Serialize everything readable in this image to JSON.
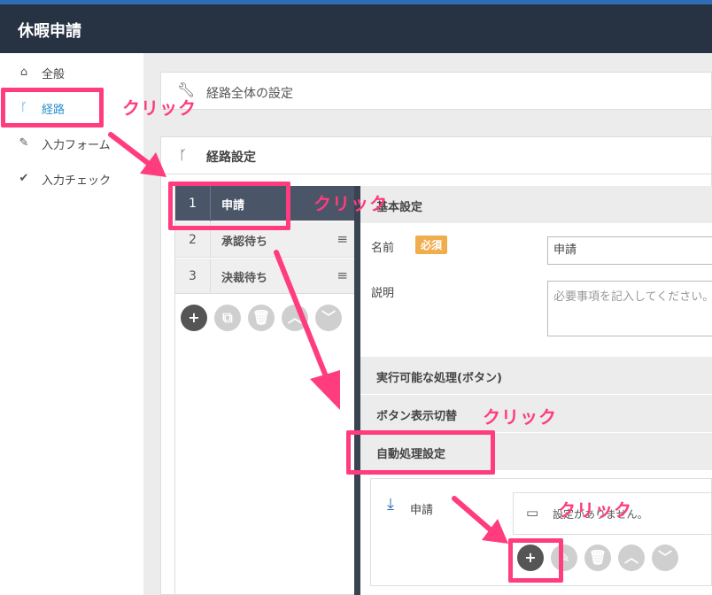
{
  "header": {
    "title": "休暇申請"
  },
  "sidebar": {
    "items": [
      {
        "label": "全般",
        "icon": "home-icon"
      },
      {
        "label": "経路",
        "icon": "route-icon"
      },
      {
        "label": "入力フォーム",
        "icon": "pencil-icon"
      },
      {
        "label": "入力チェック",
        "icon": "check-icon"
      }
    ]
  },
  "route_overall": {
    "label": "経路全体の設定"
  },
  "route_settings": {
    "label": "経路設定",
    "steps": [
      {
        "num": "1",
        "name": "申請"
      },
      {
        "num": "2",
        "name": "承認待ち"
      },
      {
        "num": "3",
        "name": "決裁待ち"
      }
    ]
  },
  "detail": {
    "basic_section": "基本設定",
    "name_label": "名前",
    "required_badge": "必須",
    "name_value": "申請",
    "desc_label": "説明",
    "desc_placeholder": "必要事項を記入してください。",
    "actions_section": "実行可能な処理(ボタン)",
    "button_toggle_section": "ボタン表示切替",
    "auto_section": "自動処理設定",
    "auto_step_label": "申請",
    "auto_empty_text": "設定がありません。"
  },
  "annotations": {
    "click": "クリック"
  },
  "colors": {
    "highlight": "#ff3c7d",
    "header": "#273242",
    "active_link": "#2a8fd0"
  }
}
